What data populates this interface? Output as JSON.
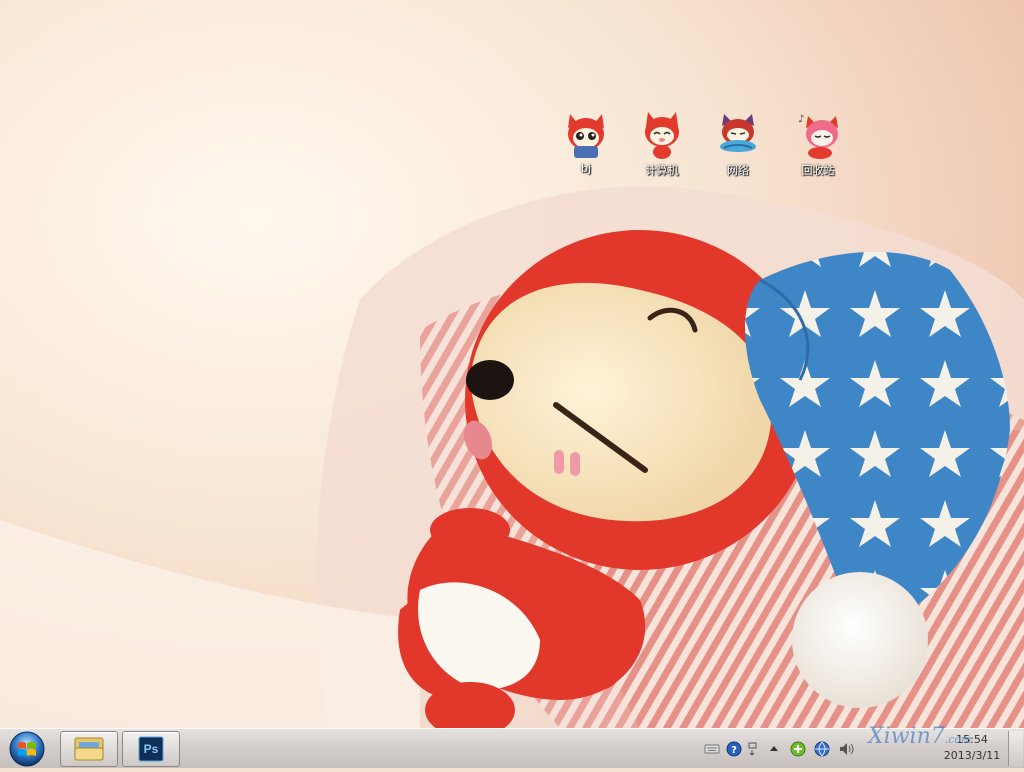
{
  "desktop": {
    "icons": [
      {
        "label": "bj",
        "icon": "ali-fox-face-icon"
      },
      {
        "label": "计算机",
        "icon": "ali-fox-computer-icon"
      },
      {
        "label": "网络",
        "icon": "ali-fox-network-icon"
      },
      {
        "label": "回收站",
        "icon": "ali-fox-recycle-bin-icon"
      }
    ]
  },
  "taskbar": {
    "start_icon": "windows-orb-icon",
    "pinned": [
      {
        "app": "Windows Explorer",
        "icon": "folder-library-icon"
      },
      {
        "app": "Photoshop",
        "icon": "ps-logo-icon",
        "text": "Ps"
      }
    ],
    "tray_icons": [
      "keyboard-icon",
      "help-icon",
      "chevron-up-icon",
      "network-plus-icon",
      "globe-icon",
      "volume-icon"
    ],
    "clock": {
      "time": "15:54",
      "date": "2013/3/11"
    }
  },
  "watermark": {
    "text": "Xiwin7",
    "suffix": ".com"
  }
}
